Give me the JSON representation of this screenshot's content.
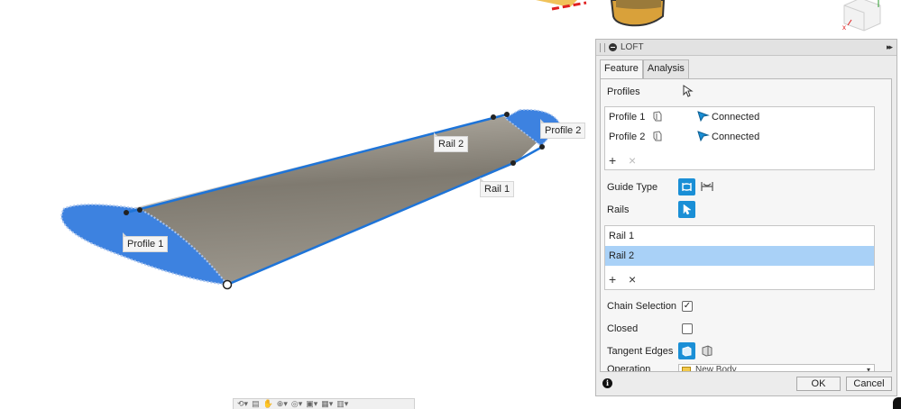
{
  "viewport": {
    "labels": {
      "profile1": "Profile 1",
      "profile2": "Profile 2",
      "rail1": "Rail 1",
      "rail2": "Rail 2"
    },
    "colors": {
      "surface": "#8a8378",
      "edge_highlight": "#1e74d8",
      "profile_fill": "#3d82e0"
    }
  },
  "nav_toolbar": {
    "icons": [
      "orbit-icon",
      "pan-icon",
      "hand-icon",
      "zoom-icon",
      "look-at-icon",
      "display-mode-icon",
      "grid-icon",
      "viewports-icon"
    ]
  },
  "panel": {
    "title": "LOFT",
    "expand_glyph": "▸▸",
    "tabs": [
      {
        "label": "Feature",
        "active": true
      },
      {
        "label": "Analysis",
        "active": false
      }
    ],
    "profiles": {
      "label": "Profiles",
      "rows": [
        {
          "name": "Profile 1",
          "status": "Connected"
        },
        {
          "name": "Profile 2",
          "status": "Connected"
        }
      ],
      "add_glyph": "+",
      "remove_glyph": "×"
    },
    "guide_type": {
      "label": "Guide Type"
    },
    "rails": {
      "label": "Rails",
      "rows": [
        {
          "name": "Rail 1",
          "selected": false
        },
        {
          "name": "Rail 2",
          "selected": true
        }
      ],
      "add_glyph": "+",
      "remove_glyph": "×"
    },
    "chain_selection": {
      "label": "Chain Selection",
      "checked": true,
      "glyph": "✓"
    },
    "closed": {
      "label": "Closed",
      "checked": false
    },
    "tangent_edges": {
      "label": "Tangent Edges"
    },
    "operation": {
      "label": "Operation",
      "value": "New Body"
    },
    "footer": {
      "info_glyph": "i",
      "ok_label": "OK",
      "cancel_label": "Cancel"
    },
    "colors": {
      "accent": "#1a8fd6",
      "selected_row": "#a9d1f7"
    }
  }
}
